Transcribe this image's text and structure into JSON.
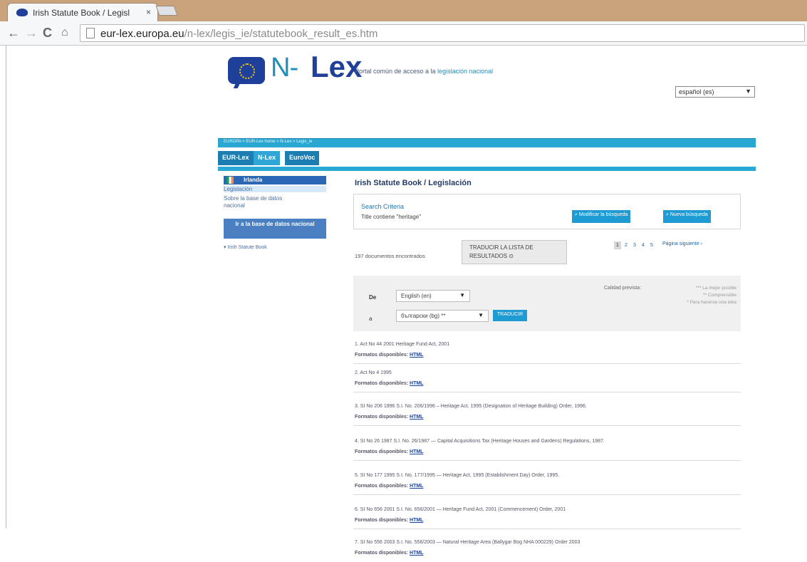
{
  "browser": {
    "tab_title": "Irish Statute Book / Legisl",
    "tab_close": "×",
    "url_host": "eur-lex.europa.eu",
    "url_path": "/n-lex/legis_ie/statutebook_result_es.htm"
  },
  "header": {
    "logo_n": "N-",
    "logo_lex": "Lex",
    "tagline_prefix": "Portal común de acceso a la ",
    "tagline_highlight": "legislación nacional",
    "language": "español (es)"
  },
  "breadcrumb": "EUROPA > EUR-Lex home > N-Lex > Legis_ie",
  "nav_tabs": [
    "EUR-Lex",
    "N-Lex",
    "EuroVoc"
  ],
  "sidebar": {
    "country": "Irlanda",
    "links": [
      "Legislación",
      "Sobre la base de datos",
      "nacional"
    ],
    "goto_button": "Ir a la base de datos nacional",
    "tree_item": "▾ Irish Statute Book"
  },
  "main": {
    "title": "Irish Statute Book / Legislación",
    "search_criteria_label": "Search Criteria",
    "search_criteria_value": "Title contiene \"heritage\"",
    "modify_button": "Modificar la búsqueda",
    "new_button": "Nueva búsqueda",
    "found_text": "197 documentos encontrados",
    "translate_list": "TRADUCIR LA LISTA DE RESULTADOS ⊙",
    "pages": [
      "1",
      "2",
      "3",
      "4",
      "5"
    ],
    "next_page": "Página siguiente ›"
  },
  "translation": {
    "de_label": "De",
    "from_lang": "English (en)",
    "a_label": "a",
    "to_lang": "български (bg) **",
    "translate_button": "TRADUCIR",
    "quality_label": "Calidad prevista:",
    "quality_items": [
      "*** La mejor posible",
      "** Comprensible",
      "* Para hacerse una idea"
    ]
  },
  "results": [
    {
      "title": "1. Act No 44 2001 Heritage Fund Act, 2001",
      "formats_label": "Formatos disponibles:",
      "format": "HTML"
    },
    {
      "title": "2. Act No 4 1995",
      "formats_label": "Formatos disponibles:",
      "format": "HTML"
    },
    {
      "title": "3. SI No 206 1996 S.I. No. 206/1996 – Heritage Act, 1995 (Designation of Heritage Building) Order, 1996.",
      "formats_label": "Formatos disponibles:",
      "format": "HTML"
    },
    {
      "title": "4. SI No 26 1987 S.I. No. 26/1987 — Capital Acquisitions Tax (Heritage Houses and Gardens) Regulations, 1987.",
      "formats_label": "Formatos disponibles:",
      "format": "HTML"
    },
    {
      "title": "5. SI No 177 1995 S.I. No. 177/1995 — Heritage Act, 1995 (Establishment Day) Order, 1995.",
      "formats_label": "Formatos disponibles:",
      "format": "HTML"
    },
    {
      "title": "6. SI No 656 2001 S.I. No. 656/2001 — Heritage Fund Act, 2001 (Commencement) Order, 2001",
      "formats_label": "Formatos disponibles:",
      "format": "HTML"
    },
    {
      "title": "7. SI No 556 2003 S.I. No. 556/2003 — Natural Heritage Area (Ballygar Bog NHA 000229) Order 2003",
      "formats_label": "Formatos disponibles:",
      "format": "HTML"
    }
  ]
}
